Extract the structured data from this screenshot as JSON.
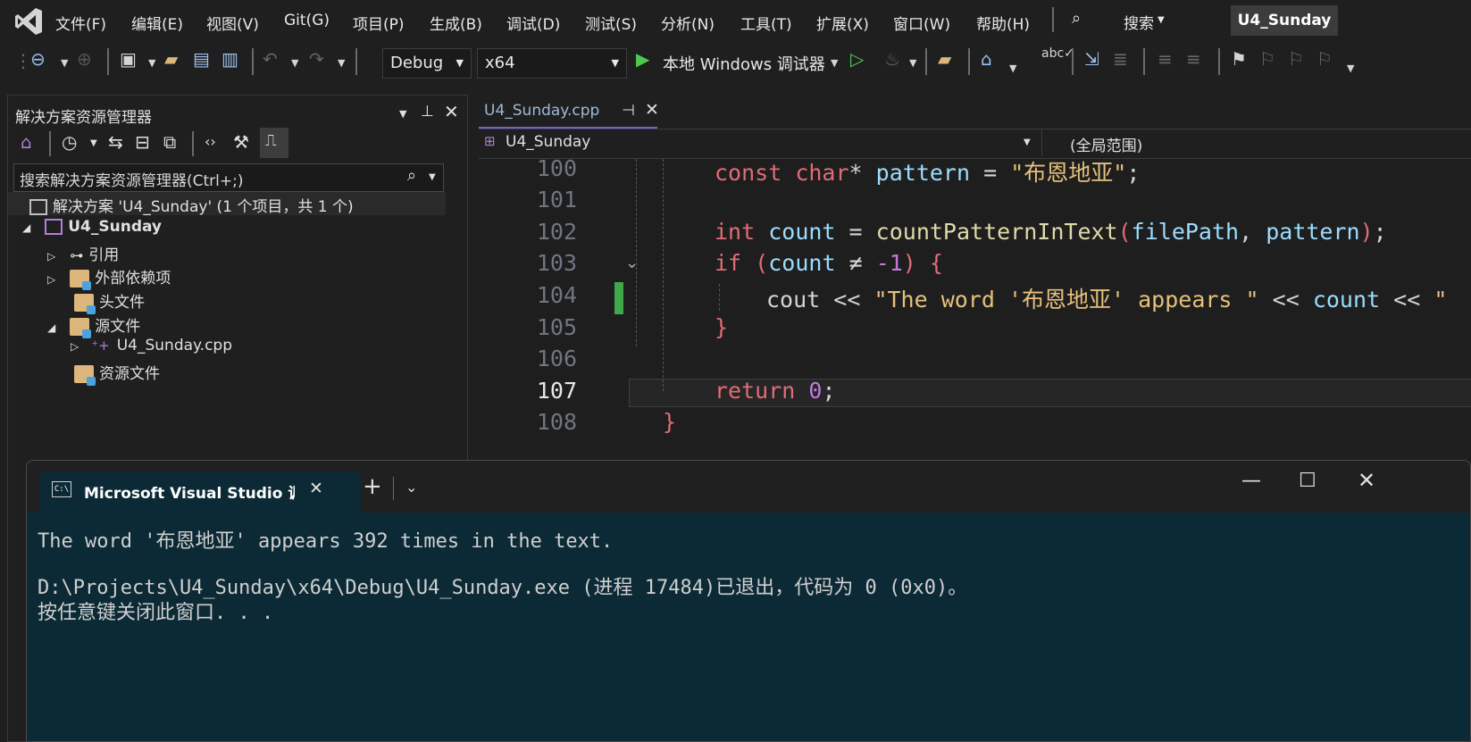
{
  "menubar": {
    "items": [
      "文件(F)",
      "编辑(E)",
      "视图(V)",
      "Git(G)",
      "项目(P)",
      "生成(B)",
      "调试(D)",
      "测试(S)",
      "分析(N)",
      "工具(T)",
      "扩展(X)",
      "窗口(W)",
      "帮助(H)"
    ],
    "search_label": "搜索",
    "solution_name": "U4_Sunday"
  },
  "toolbar": {
    "config": "Debug",
    "platform": "x64",
    "debugger": "本地 Windows 调试器"
  },
  "solution_explorer": {
    "title": "解决方案资源管理器",
    "search_placeholder": "搜索解决方案资源管理器(Ctrl+;)",
    "solution_row": "解决方案 'U4_Sunday' (1 个项目，共 1 个)",
    "project": "U4_Sunday",
    "references": "引用",
    "external_deps": "外部依赖项",
    "header_files": "头文件",
    "source_files": "源文件",
    "cpp_file": "U4_Sunday.cpp",
    "resource_files": "资源文件"
  },
  "editor": {
    "tab_label": "U4_Sunday.cpp",
    "scope_left": "U4_Sunday",
    "scope_right": "(全局范围)",
    "line_numbers": [
      "100",
      "101",
      "102",
      "103",
      "104",
      "105",
      "106",
      "107",
      "108"
    ],
    "current_line": "107"
  },
  "console": {
    "tab_title": "Microsoft Visual Studio 调试控",
    "line1": "The word '布恩地亚' appears 392 times in the text.",
    "line2": "D:\\Projects\\U4_Sunday\\x64\\Debug\\U4_Sunday.exe (进程 17484)已退出，代码为 0 (0x0)。",
    "line3": "按任意键关闭此窗口. . ."
  }
}
